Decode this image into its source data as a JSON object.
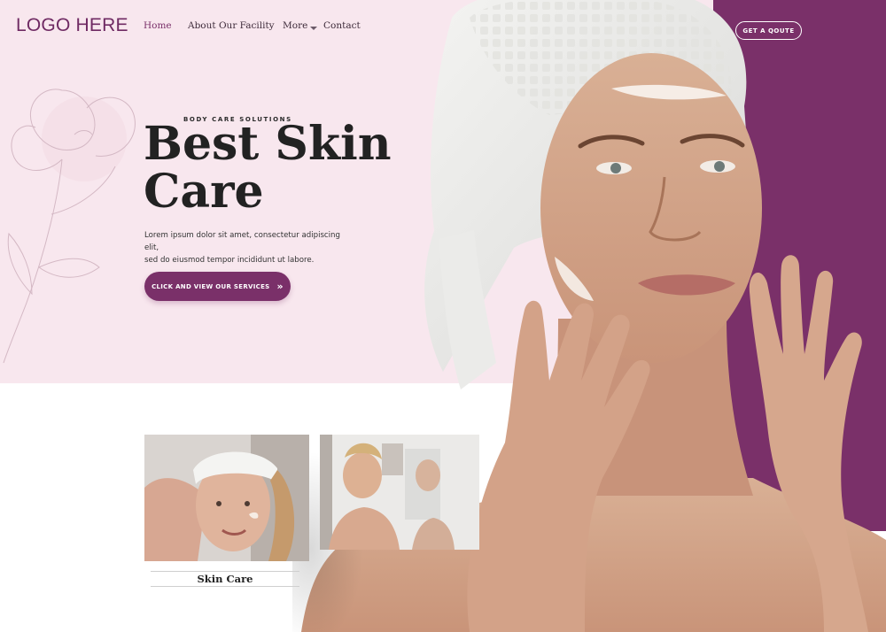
{
  "brand": {
    "logo": "LOGO HERE"
  },
  "nav": {
    "items": [
      {
        "label": "Home",
        "active": true
      },
      {
        "label": "About Our Facility"
      },
      {
        "label": "More",
        "has_dropdown": true
      },
      {
        "label": "Contact"
      }
    ],
    "cta_label": "GET A QOUTE"
  },
  "hero": {
    "eyebrow": "BODY CARE SOLUTIONS",
    "title_line1": "Best Skin",
    "title_line2": "Care",
    "body_line1": "Lorem ipsum dolor sit amet, consectetur adipiscing elit,",
    "body_line2": "sed do eiusmod tempor incididunt ut labore.",
    "cta_label": "CLICK AND VIEW OUR SERVICES",
    "cta_icon": "double-chevron-right-icon",
    "image": "woman-with-towel-applying-face-cream"
  },
  "services": [
    {
      "label": "Skin Care",
      "image": "woman-with-headband-face-cream"
    },
    {
      "label": "",
      "image": "women-in-bathroom-skincare"
    }
  ],
  "colors": {
    "primary": "#7a3069",
    "hero_bg": "#f8e7ee",
    "text_dark": "#222222",
    "white": "#ffffff"
  }
}
